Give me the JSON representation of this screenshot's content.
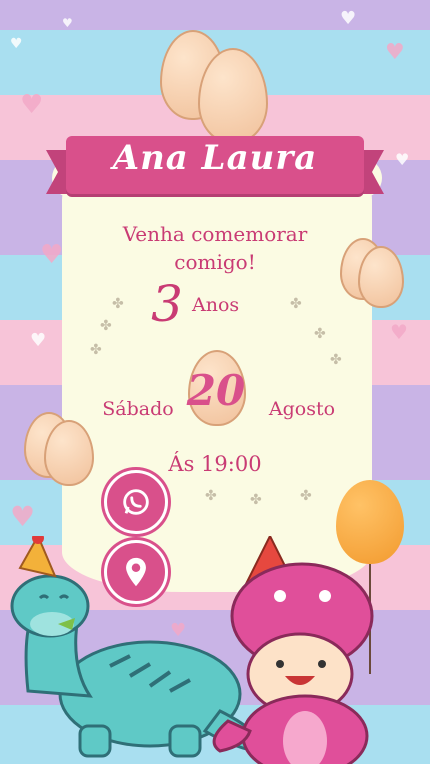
{
  "invitation": {
    "name": "Ana Laura",
    "invite_line": "Venha comemorar comigo!",
    "age_number": "3",
    "age_word": "Anos",
    "weekday": "Sábado",
    "day": "20",
    "month": "Agosto",
    "time": "Ás 19:00"
  },
  "buttons": {
    "whatsapp_icon": "whatsapp-icon",
    "location_icon": "location-pin-icon"
  },
  "colors": {
    "accent": "#d9508b",
    "text": "#c93b74",
    "card": "#fbfbe3",
    "stripe_lavender": "#c9b4e6",
    "stripe_blue": "#a9dff0",
    "stripe_pink": "#f7c4d8"
  }
}
